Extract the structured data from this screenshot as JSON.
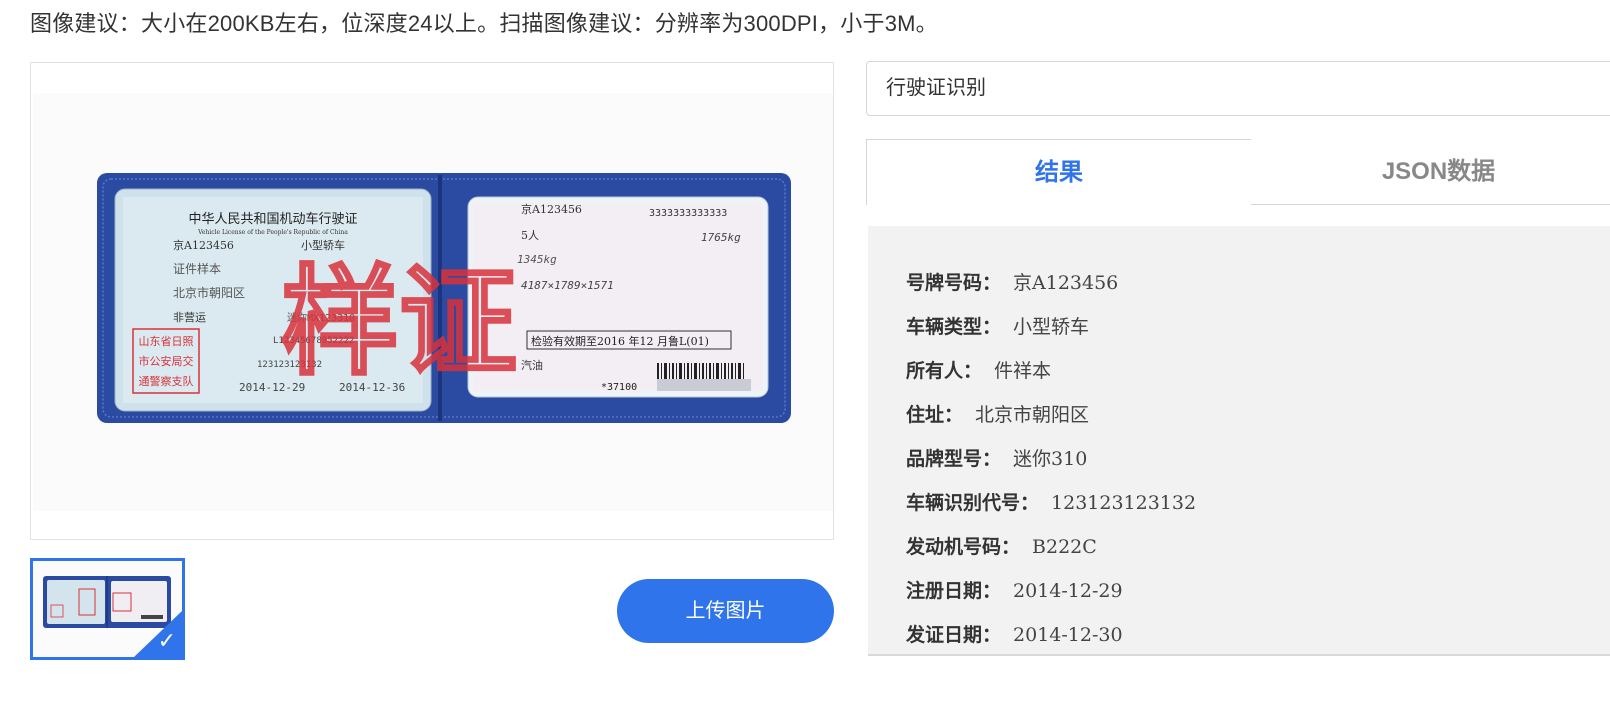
{
  "hint": "图像建议：大小在200KB左右，位深度24以上。扫描图像建议：分辨率为300DPI，小于3M。",
  "document": {
    "left_card": {
      "title": "中华人民共和国机动车行驶证",
      "subtitle": "Vehicle License of the People's Republic of China",
      "plate": "京A123456",
      "vehicle_type": "小型轿车",
      "owner": "证件样本",
      "address": "北京市朝阳区",
      "use_character": "非营运",
      "model": "迷你MX123310",
      "vin": "L12345678952222",
      "engine": "123123123132",
      "register_date": "2014-12-29",
      "issue_date": "2014-12-36",
      "stamp_lines": [
        "山东省日照",
        "市公安局交",
        "通警察支队"
      ],
      "watermark": "样证"
    },
    "right_card": {
      "plate": "京A123456",
      "file_no": "3333333333333",
      "seats": "5人",
      "total_mass": "1765kg",
      "curb_mass": "1345kg",
      "dimensions": "4187×1789×1571",
      "inspection": "检验有效期至2016 年12 月鲁L(01)",
      "note": "汽油",
      "barcode_no": "*37100"
    }
  },
  "upload_label": "上传图片",
  "select_value": "行驶证识别",
  "tabs": {
    "result": "结果",
    "json": "JSON数据"
  },
  "results": [
    {
      "key": "号牌号码：",
      "value": "京A123456"
    },
    {
      "key": "车辆类型：",
      "value": "小型轿车"
    },
    {
      "key": "所有人：",
      "value": "件祥本"
    },
    {
      "key": "住址：",
      "value": "北京市朝阳区"
    },
    {
      "key": "品牌型号：",
      "value": "迷你310"
    },
    {
      "key": "车辆识别代号：",
      "value": "123123123132"
    },
    {
      "key": "发动机号码：",
      "value": "B222C"
    },
    {
      "key": "注册日期：",
      "value": "2014-12-29"
    },
    {
      "key": "发证日期：",
      "value": "2014-12-30"
    }
  ],
  "colors": {
    "accent": "#2f74ea",
    "cover": "#2b4aa1",
    "stamp": "#d8323c"
  }
}
